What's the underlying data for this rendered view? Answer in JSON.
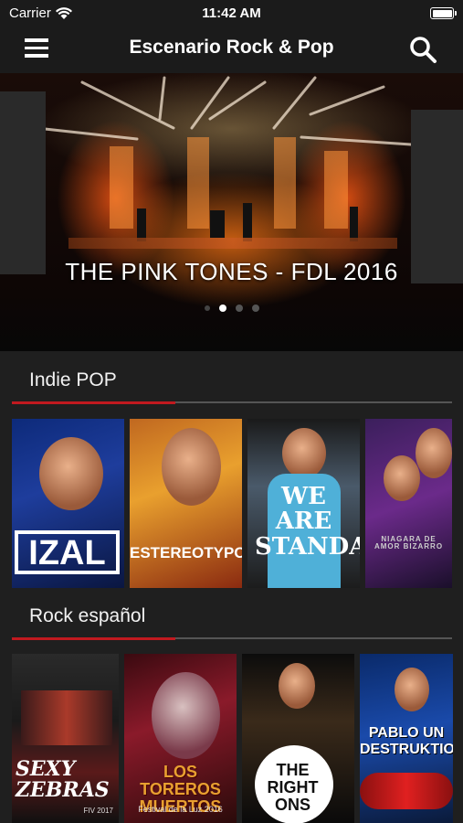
{
  "status_bar": {
    "carrier": "Carrier",
    "time": "11:42 AM",
    "battery_level": 1.0
  },
  "nav": {
    "title": "Escenario Rock & Pop",
    "menu_icon": "hamburger-menu-icon",
    "search_icon": "search-icon"
  },
  "hero": {
    "title": "THE PINK TONES - FDL 2016",
    "pager": {
      "count": 4,
      "active_index": 1
    }
  },
  "sections": [
    {
      "title": "Indie POP",
      "accent_color": "#c1191f",
      "items": [
        {
          "label": "IZAL"
        },
        {
          "label": "ESTEREOTYPO"
        },
        {
          "label": "WE ARE STANDARD"
        },
        {
          "label": "NIAGARA DE AMOR BIZARRO"
        }
      ]
    },
    {
      "title": "Rock español",
      "accent_color": "#c1191f",
      "items": [
        {
          "label": "SEXY ZEBRAS",
          "caption": "FIV 2017"
        },
        {
          "label": "LOS TOREROS MUERTOS",
          "caption": "Festival de la Luz 2016"
        },
        {
          "label": "THE RIGHT ONS"
        },
        {
          "label": "PABLO UN DESTRUKTIO"
        }
      ]
    }
  ],
  "colors": {
    "background": "#1f1f1f",
    "bar": "#1b1b1b",
    "accent": "#c1191f",
    "divider": "#555555"
  }
}
